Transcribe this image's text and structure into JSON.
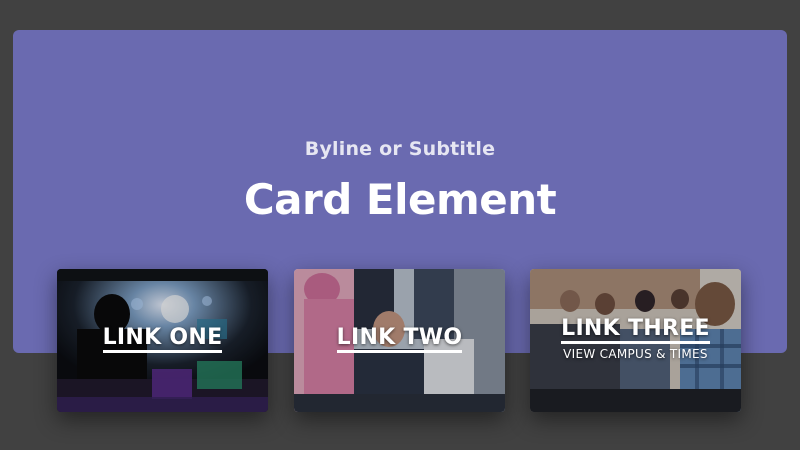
{
  "hero": {
    "byline": "Byline or Subtitle",
    "title": "Card Element",
    "background_color": "#6a6ab0"
  },
  "cards": [
    {
      "label": "LINK ONE",
      "image": "photo of a worship sound booth with stage lights"
    },
    {
      "label": "LINK TWO",
      "image": "photo of children and a volunteer in a classroom"
    },
    {
      "label": "LINK THREE",
      "sublabel": "VIEW CAMPUS & TIMES",
      "image": "photo of a congregation seated in a church"
    }
  ]
}
